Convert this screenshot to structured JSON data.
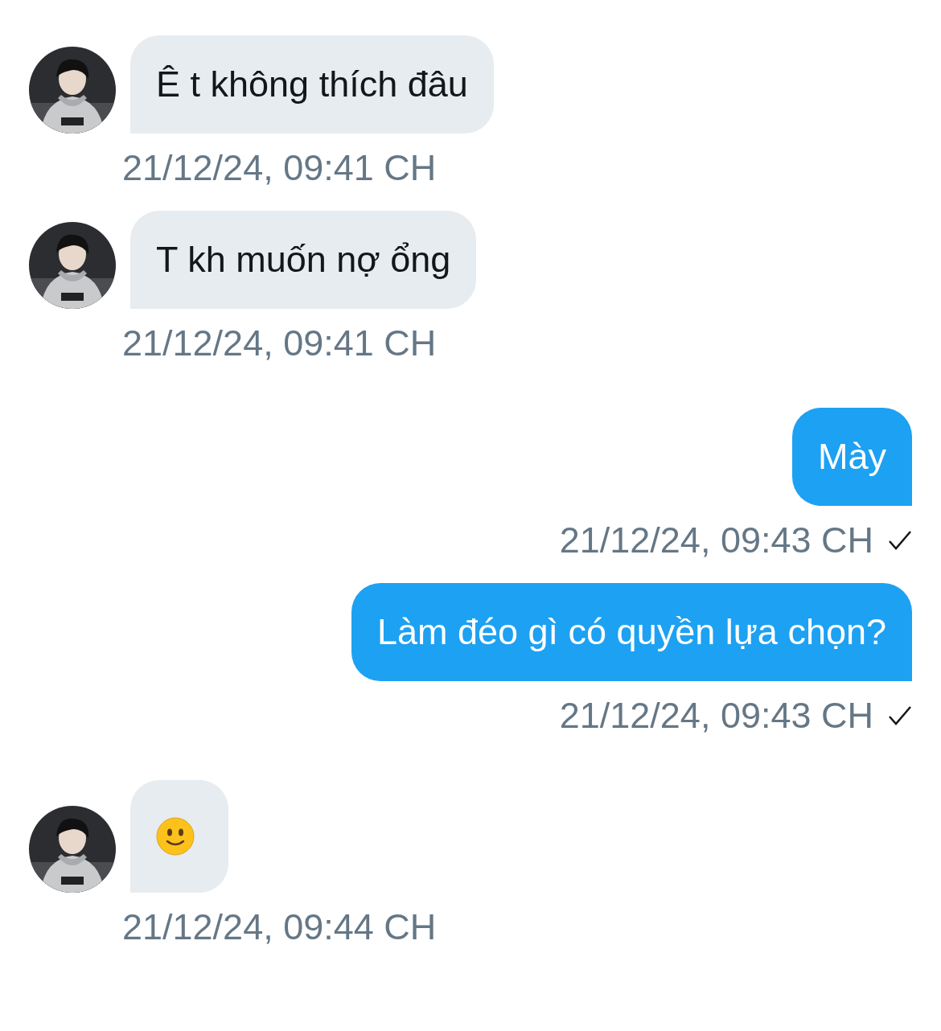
{
  "messages": [
    {
      "kind": "received",
      "text": "Ê t không thích đâu",
      "time": "21/12/24, 09:41 CH"
    },
    {
      "kind": "received",
      "text": "T kh muốn nợ ổng",
      "time": "21/12/24, 09:41 CH"
    },
    {
      "kind": "sent",
      "text": "Mày",
      "time": "21/12/24, 09:43 CH",
      "delivered": true
    },
    {
      "kind": "sent",
      "text": "Làm đéo gì có quyền lựa chọn?",
      "time": "21/12/24, 09:43 CH",
      "delivered": true
    },
    {
      "kind": "received_emoji",
      "time": "21/12/24, 09:44 CH"
    }
  ]
}
